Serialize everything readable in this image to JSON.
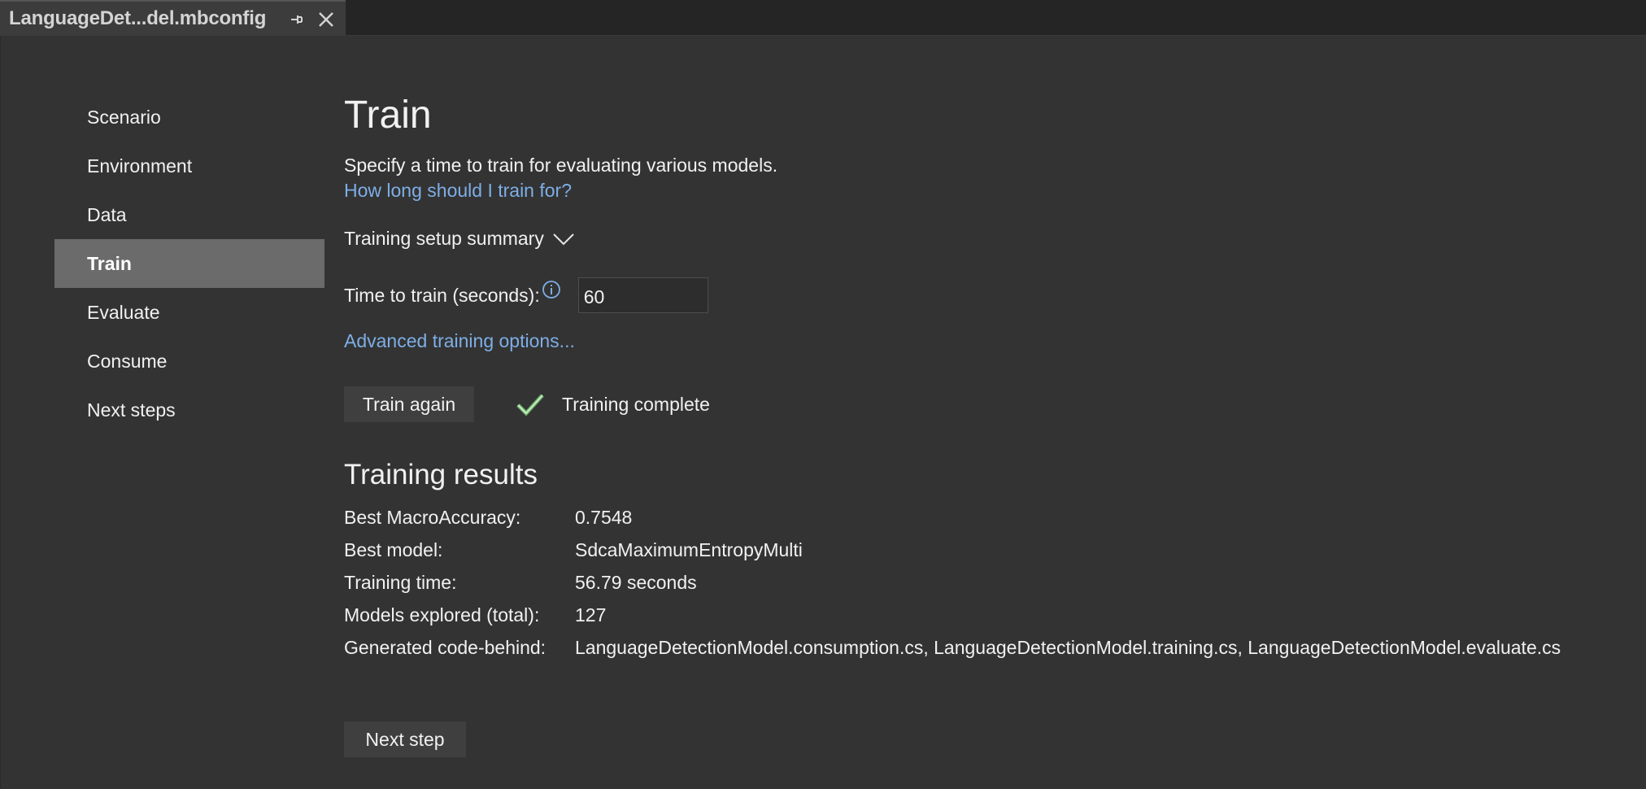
{
  "tab": {
    "title": "LanguageDet...del.mbconfig"
  },
  "nav": {
    "items": [
      {
        "label": "Scenario"
      },
      {
        "label": "Environment"
      },
      {
        "label": "Data"
      },
      {
        "label": "Train",
        "active": true
      },
      {
        "label": "Evaluate"
      },
      {
        "label": "Consume"
      },
      {
        "label": "Next steps"
      }
    ]
  },
  "train": {
    "title": "Train",
    "description": "Specify a time to train for evaluating various models.",
    "help_link": "How long should I train for?",
    "summary_toggle": "Training setup summary",
    "time_label": "Time to train (seconds):",
    "time_value": "60",
    "advanced_link": "Advanced training options...",
    "train_again_label": "Train again",
    "status_text": "Training complete",
    "next_step_label": "Next step"
  },
  "results": {
    "title": "Training results",
    "rows": [
      {
        "label": "Best MacroAccuracy:",
        "value": "0.7548"
      },
      {
        "label": "Best model:",
        "value": "SdcaMaximumEntropyMulti"
      },
      {
        "label": "Training time:",
        "value": "56.79 seconds"
      },
      {
        "label": "Models explored (total):",
        "value": "127"
      },
      {
        "label": "Generated code-behind:",
        "value": "LanguageDetectionModel.consumption.cs, LanguageDetectionModel.training.cs, LanguageDetectionModel.evaluate.cs"
      }
    ]
  },
  "colors": {
    "background": "#333333",
    "nav_active": "#6b6b6b",
    "link": "#7eaee6",
    "check": "#8fd18c"
  }
}
